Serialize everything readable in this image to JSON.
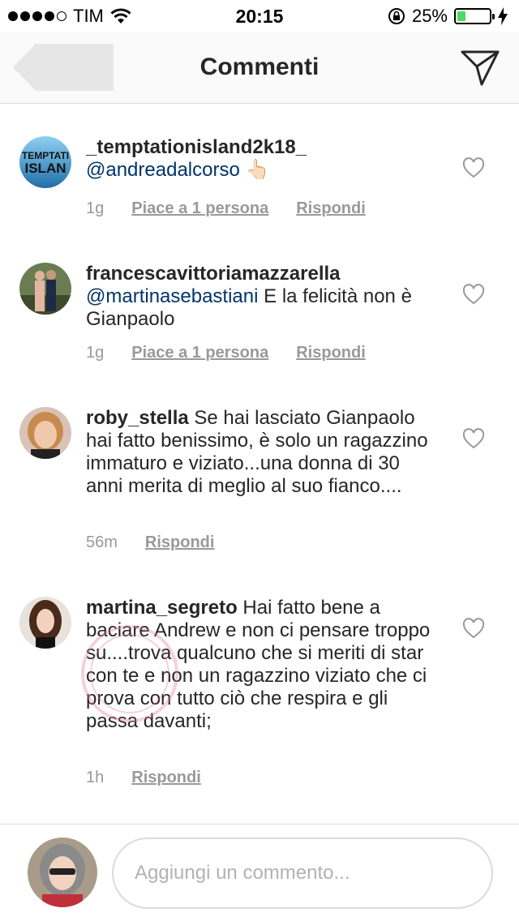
{
  "status_bar": {
    "carrier": "TIM",
    "time": "20:15",
    "battery": "25%",
    "battery_level": 0.25,
    "icons": [
      "signal-dots",
      "wifi-icon",
      "rotation-lock-icon",
      "battery-icon",
      "charging-icon"
    ]
  },
  "nav": {
    "title": "Commenti",
    "icons": [
      "back-arrow-icon",
      "send-icon"
    ]
  },
  "comments": [
    {
      "username": "_temptationisland2k18_",
      "mention": "@andreadalcorso",
      "text": "👆🏻",
      "time": "1g",
      "likes": "Piace a 1 persona",
      "reply": "Rispondi"
    },
    {
      "username": "francescavittoriamazzarella",
      "mention": "@martinasebastiani",
      "text": "  E la felicità non è Gianpaolo",
      "time": "1g",
      "likes": "Piace a 1 persona",
      "reply": "Rispondi"
    },
    {
      "username": "roby_stella",
      "mention": "",
      "text": "Se hai lasciato Gianpaolo hai fatto benissimo, è solo un ragazzino immaturo e viziato...una donna di 30 anni merita di meglio al suo fianco....",
      "time": "56m",
      "likes": "",
      "reply": "Rispondi"
    },
    {
      "username": "martina_segreto",
      "mention": "",
      "text": "Hai fatto bene a baciare Andrew e non ci pensare troppo su....trova qualcuno che si meriti di star con te e non un ragazzino viziato che ci prova con tutto ciò che respira e gli passa davanti;",
      "time": "1h",
      "likes": "",
      "reply": "Rispondi"
    }
  ],
  "avatar_logo_text": "TEMPTATION ISLAND",
  "footer": {
    "placeholder": "Aggiungi un commento..."
  },
  "colors": {
    "mention": "#003569",
    "meta": "#999999",
    "border": "#dbdbdb",
    "battery": "#4cd964"
  }
}
